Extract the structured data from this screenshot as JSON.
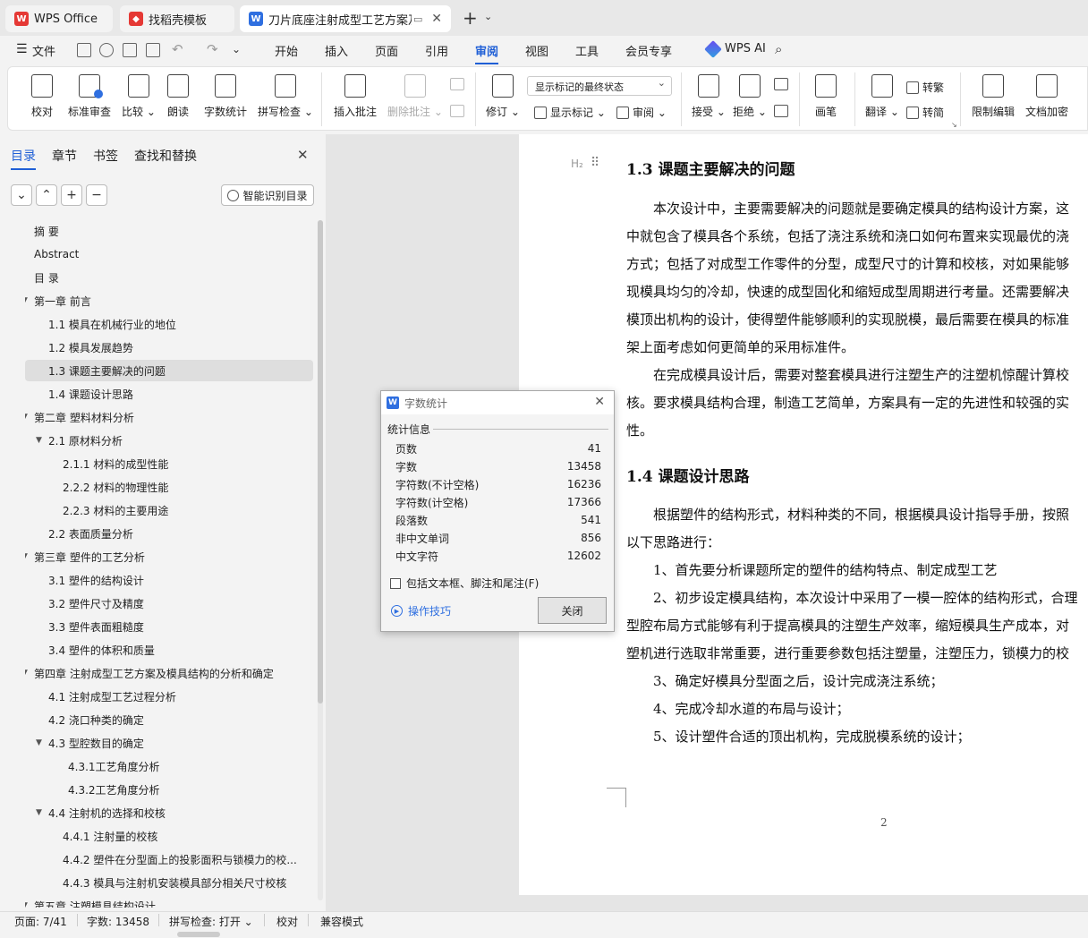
{
  "tabs": [
    {
      "label": "WPS Office",
      "icon": "wps-logo-icon"
    },
    {
      "label": "找稻壳模板",
      "icon": "docer-logo-icon"
    },
    {
      "label": "刀片底座注射成型工艺方案及",
      "icon": "writer-doc-icon"
    }
  ],
  "menubar": {
    "file": "文件",
    "items": [
      "开始",
      "插入",
      "页面",
      "引用",
      "审阅",
      "视图",
      "工具",
      "会员专享"
    ],
    "active": "审阅",
    "wps_ai": "WPS AI"
  },
  "ribbon": {
    "proofread": "校对",
    "standard_review": "标准审查",
    "compare": "比较",
    "read_aloud": "朗读",
    "word_count": "字数统计",
    "spell_check": "拼写检查",
    "insert_comment": "插入批注",
    "delete_comment": "删除批注",
    "revise": "修订",
    "markup_state": "显示标记的最终状态",
    "show_markup": "显示标记",
    "review": "审阅",
    "accept": "接受",
    "reject": "拒绝",
    "pen": "画笔",
    "translate": "翻译",
    "to_traditional": "转繁",
    "to_simplified": "转简",
    "restrict_edit": "限制编辑",
    "doc_encrypt": "文档加密"
  },
  "nav": {
    "tabs": [
      "目录",
      "章节",
      "书签",
      "查找和替换"
    ],
    "smart_btn": "智能识别目录",
    "toc": [
      {
        "label": "摘    要",
        "level": 0
      },
      {
        "label": "Abstract",
        "level": 0
      },
      {
        "label": "目    录",
        "level": 0
      },
      {
        "label": "第一章   前言",
        "level": 0,
        "expand": true
      },
      {
        "label": "1.1  模具在机械行业的地位",
        "level": 1
      },
      {
        "label": "1.2  模具发展趋势",
        "level": 1
      },
      {
        "label": "1.3  课题主要解决的问题",
        "level": 1,
        "selected": true
      },
      {
        "label": "1.4  课题设计思路",
        "level": 1
      },
      {
        "label": "第二章   塑料材料分析",
        "level": 0,
        "expand": true
      },
      {
        "label": "2.1  原材料分析",
        "level": 1,
        "expand": true
      },
      {
        "label": "2.1.1 材料的成型性能",
        "level": 2
      },
      {
        "label": "2.2.2  材料的物理性能",
        "level": 2
      },
      {
        "label": "2.2.3  材料的主要用途",
        "level": 2
      },
      {
        "label": "2.2 表面质量分析",
        "level": 1
      },
      {
        "label": "第三章   塑件的工艺分析",
        "level": 0,
        "expand": true
      },
      {
        "label": "3.1    塑件的结构设计",
        "level": 1
      },
      {
        "label": "3.2    塑件尺寸及精度",
        "level": 1
      },
      {
        "label": "3.3    塑件表面粗糙度",
        "level": 1
      },
      {
        "label": "3.4    塑件的体积和质量",
        "level": 1
      },
      {
        "label": "第四章   注射成型工艺方案及模具结构的分析和确定",
        "level": 0,
        "expand": true
      },
      {
        "label": "4.1  注射成型工艺过程分析",
        "level": 1
      },
      {
        "label": "4.2 浇口种类的确定",
        "level": 1
      },
      {
        "label": "4.3  型腔数目的确定",
        "level": 1,
        "expand": true
      },
      {
        "label": "4.3.1工艺角度分析",
        "level": 3
      },
      {
        "label": "4.3.2工艺角度分析",
        "level": 3
      },
      {
        "label": "4.4  注射机的选择和校核",
        "level": 1,
        "expand": true
      },
      {
        "label": "4.4.1    注射量的校核",
        "level": 2
      },
      {
        "label": "4.4.2    塑件在分型面上的投影面积与锁模力的校...",
        "level": 2
      },
      {
        "label": "4.4.3  模具与注射机安装模具部分相关尺寸校核",
        "level": 2
      },
      {
        "label": "第五章   注塑模具结构设计",
        "level": 0,
        "expand": true
      }
    ]
  },
  "document": {
    "h1": "1.3  课题主要解决的问题",
    "heading_marker": "H₂",
    "para1": [
      "本次设计中，主要需要解决的问题就是要确定模具的结构设计方案，这",
      "中就包含了模具各个系统，包括了浇注系统和浇口如何布置来实现最优的浇",
      "方式；包括了对成型工作零件的分型，成型尺寸的计算和校核，对如果能够",
      "现模具均匀的冷却，快速的成型固化和缩短成型周期进行考量。还需要解决",
      "模顶出机构的设计，使得塑件能够顺利的实现脱模，最后需要在模具的标准",
      "架上面考虑如何更简单的采用标准件。"
    ],
    "para2": [
      "在完成模具设计后，需要对整套模具进行注塑生产的注塑机惊醒计算校",
      "核。要求模具结构合理，制造工艺简单，方案具有一定的先进性和较强的实",
      "性。"
    ],
    "h2": "1.4  课题设计思路",
    "para3": [
      "根据塑件的结构形式，材料种类的不同，根据模具设计指导手册，按照",
      "以下思路进行："
    ],
    "list": [
      "1、首先要分析课题所定的塑件的结构特点、制定成型工艺",
      "2、初步设定模具结构，本次设计中采用了一模一腔体的结构形式，合理",
      "型腔布局方式能够有利于提高模具的注塑生产效率，缩短模具生产成本，对",
      "塑机进行选取非常重要，进行重要参数包括注塑量，注塑压力，锁模力的校",
      "3、确定好模具分型面之后，设计完成浇注系统；",
      "4、完成冷却水道的布局与设计；",
      "5、设计塑件合适的顶出机构，完成脱模系统的设计；"
    ],
    "page_number": "2"
  },
  "dialog": {
    "title": "字数统计",
    "section": "统计信息",
    "stats": [
      {
        "label": "页数",
        "value": "41"
      },
      {
        "label": "字数",
        "value": "13458"
      },
      {
        "label": "字符数(不计空格)",
        "value": "16236"
      },
      {
        "label": "字符数(计空格)",
        "value": "17366"
      },
      {
        "label": "段落数",
        "value": "541"
      },
      {
        "label": "非中文单词",
        "value": "856"
      },
      {
        "label": "中文字符",
        "value": "12602"
      }
    ],
    "checkbox": "包括文本框、脚注和尾注(F)",
    "tips": "操作技巧",
    "close": "关闭"
  },
  "status": {
    "page": "页面: 7/41",
    "words": "字数: 13458",
    "spell": "拼写检查: 打开",
    "proof": "校对",
    "compat": "兼容模式"
  }
}
